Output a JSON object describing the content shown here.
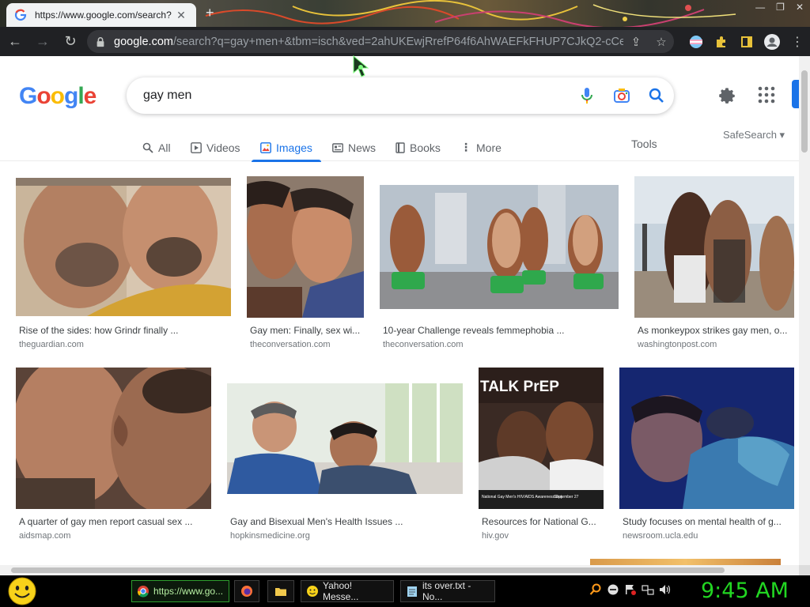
{
  "browser": {
    "tab_title": "https://www.google.com/search?",
    "url_domain": "google.com",
    "url_path": "/search?q=gay+men+&tbm=isch&ved=2ahUKEwjRrefP64f6AhWAEFkFHUP7CJkQ2-cCeg..."
  },
  "google": {
    "logo_letters": [
      "G",
      "o",
      "o",
      "g",
      "l",
      "e"
    ],
    "query": "gay men",
    "tabs": [
      {
        "label": "All",
        "icon": "search-icon",
        "active": false
      },
      {
        "label": "Videos",
        "icon": "play-icon",
        "active": false
      },
      {
        "label": "Images",
        "icon": "image-icon",
        "active": true
      },
      {
        "label": "News",
        "icon": "news-icon",
        "active": false
      },
      {
        "label": "Books",
        "icon": "book-icon",
        "active": false
      },
      {
        "label": "More",
        "icon": "more-vertical-icon",
        "active": false
      }
    ],
    "tools_label": "Tools",
    "safesearch_label": "SafeSearch ▾",
    "results": [
      {
        "title": "Rise of the sides: how Grindr finally ...",
        "source": "theguardian.com"
      },
      {
        "title": "Gay men: Finally, sex wi...",
        "source": "theconversation.com"
      },
      {
        "title": "10-year Challenge reveals femmephobia ...",
        "source": "theconversation.com"
      },
      {
        "title": "As monkeypox strikes gay men, o...",
        "source": "washingtonpost.com"
      },
      {
        "title": "A quarter of gay men report casual sex ...",
        "source": "aidsmap.com"
      },
      {
        "title": "Gay and Bisexual Men's Health Issues ...",
        "source": "hopkinsmedicine.org"
      },
      {
        "title": "Resources for National G...",
        "source": "hiv.gov"
      },
      {
        "title": "Study focuses on mental health of g...",
        "source": "newsroom.ucla.edu"
      }
    ],
    "prep_poster": {
      "headline": "TALK PrEP",
      "footer_left": "National Gay Men's HIV/AIDS Awareness Day",
      "footer_right": "September 27"
    }
  },
  "taskbar": {
    "tasks": [
      "https://www.go...",
      "Yahoo! Messe...",
      "its over.txt - No..."
    ],
    "clock": "9:45 AM"
  },
  "colors": {
    "accent": "#1a73e8",
    "clock": "#22d622"
  }
}
